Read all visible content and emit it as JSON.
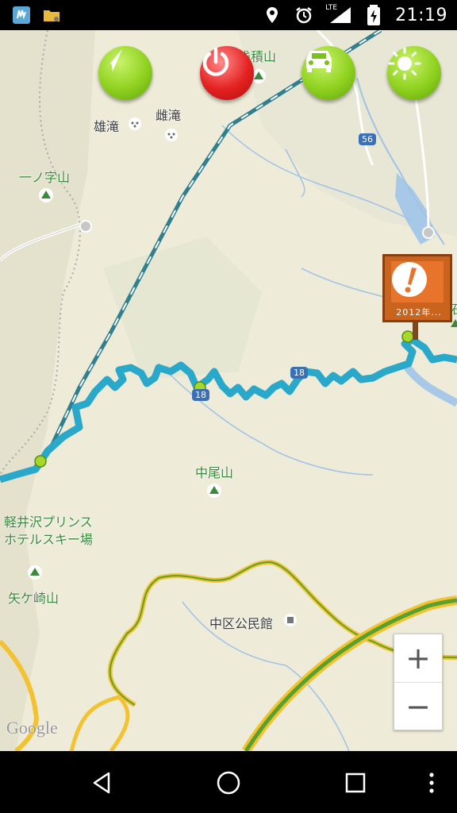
{
  "status_bar": {
    "time": "21:19",
    "network": "LTE",
    "icons": [
      "app-notification-icon",
      "folder-icon",
      "location-icon",
      "alarm-icon",
      "signal-icon",
      "battery-charging-icon"
    ]
  },
  "controls": {
    "buttons": [
      {
        "name": "navigate-button",
        "icon": "navigation-arrow-icon",
        "color": "#8fd11f"
      },
      {
        "name": "power-button",
        "icon": "power-icon",
        "color": "#e42121"
      },
      {
        "name": "car-button",
        "icon": "car-icon",
        "color": "#8fd11f"
      },
      {
        "name": "brightness-button",
        "icon": "sun-icon",
        "color": "#8fd11f"
      }
    ]
  },
  "map": {
    "labels": {
      "yudaki": "雄滝",
      "medaki": "雌滝",
      "ichinojiyama": "一ノ字山",
      "nakaoyama": "中尾山",
      "karuizawa_line1": "軽井沢プリンス",
      "karuizawa_line2": "ホテルスキー場",
      "yagasakiyama": "矢ケ崎山",
      "nakaku_kouminkan": "中区公民館",
      "top_peak": "浅積山",
      "right_edge": "石"
    },
    "route_shields": {
      "r56": "56",
      "r18": "18",
      "r18b": "18"
    },
    "warning": {
      "caption": "2012年...",
      "icon": "exclamation-icon"
    },
    "zoom": {
      "plus": "+",
      "minus": "−"
    },
    "attribution": "Google",
    "colors": {
      "route": "#29a8c9",
      "rail": "#2f7f8f",
      "highway_outer": "#f2c230",
      "highway_inner": "#5aa02c",
      "land": "#eeebd9",
      "water": "#a8c8e8"
    }
  },
  "nav_bar": {
    "buttons": [
      "back-icon",
      "home-icon",
      "recents-icon",
      "overflow-menu-icon"
    ]
  }
}
